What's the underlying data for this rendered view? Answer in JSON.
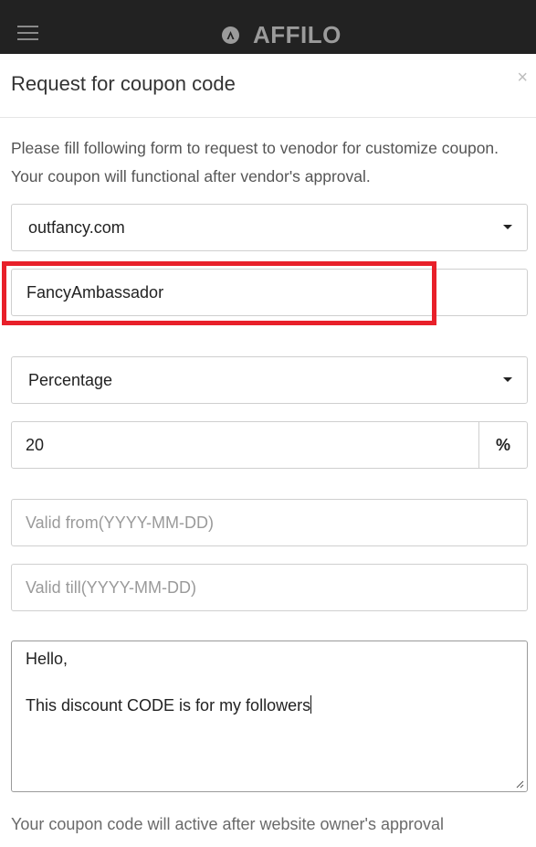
{
  "app": {
    "brand": "AFFILO"
  },
  "modal": {
    "title": "Request for coupon code",
    "close_symbol": "×",
    "intro": "Please fill following form to request to venodor for customize coupon. Your coupon will functional after vendor's approval."
  },
  "form": {
    "vendor": {
      "value": "outfancy.com"
    },
    "coupon_code": {
      "value": "FancyAmbassador"
    },
    "discount_type": {
      "value": "Percentage"
    },
    "amount": {
      "value": "20",
      "unit": "%"
    },
    "valid_from": {
      "placeholder": "Valid from(YYYY-MM-DD)"
    },
    "valid_till": {
      "placeholder": "Valid till(YYYY-MM-DD)"
    },
    "message": {
      "line1": "Hello,",
      "line2": "This discount CODE is for my followers"
    },
    "footer_note": "Your coupon code will active after website owner's approval"
  },
  "colors": {
    "topbar": "#222222",
    "highlight": "#e8202a"
  },
  "icons": {
    "menu": "hamburger-menu-icon",
    "logo": "affilo-logo-icon",
    "close": "close-icon",
    "dropdown": "caret-down-icon",
    "resize": "resize-grip-icon"
  }
}
